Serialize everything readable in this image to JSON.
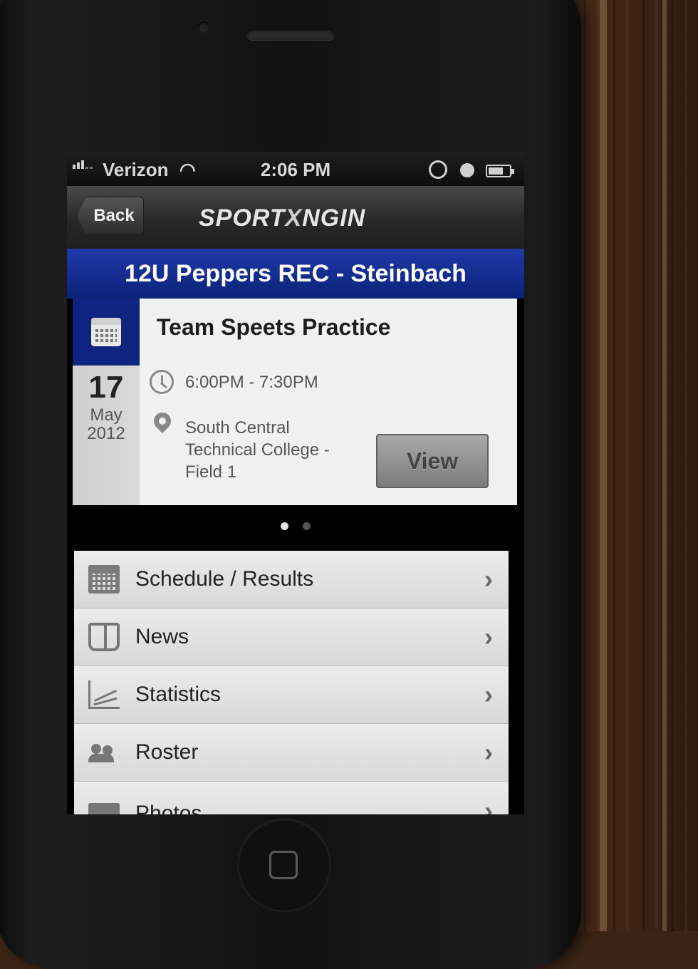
{
  "status_bar": {
    "carrier": "Verizon",
    "wifi_icon": "wifi-icon",
    "time": "2:06 PM"
  },
  "nav": {
    "back_label": "Back",
    "brand": "SPORT",
    "brand_x": "X",
    "brand_tail": "NGIN"
  },
  "team": {
    "name": "12U Peppers REC - Steinbach"
  },
  "event": {
    "day": "17",
    "month": "May",
    "year": "2012",
    "title": "Team Speets Practice",
    "time": "6:00PM - 7:30PM",
    "location": "South Central Technical College - Field 1",
    "view_label": "View"
  },
  "pager": {
    "pages": 2,
    "current": 1
  },
  "menu": {
    "items": [
      {
        "label": "Schedule / Results",
        "icon": "calendar-icon"
      },
      {
        "label": "News",
        "icon": "news-icon"
      },
      {
        "label": "Statistics",
        "icon": "statistics-icon"
      },
      {
        "label": "Roster",
        "icon": "roster-icon"
      },
      {
        "label": "Photos",
        "icon": "photos-icon"
      }
    ]
  },
  "colors": {
    "team_bar": "#0b2379",
    "nav_bar": "#2a2a2a"
  }
}
